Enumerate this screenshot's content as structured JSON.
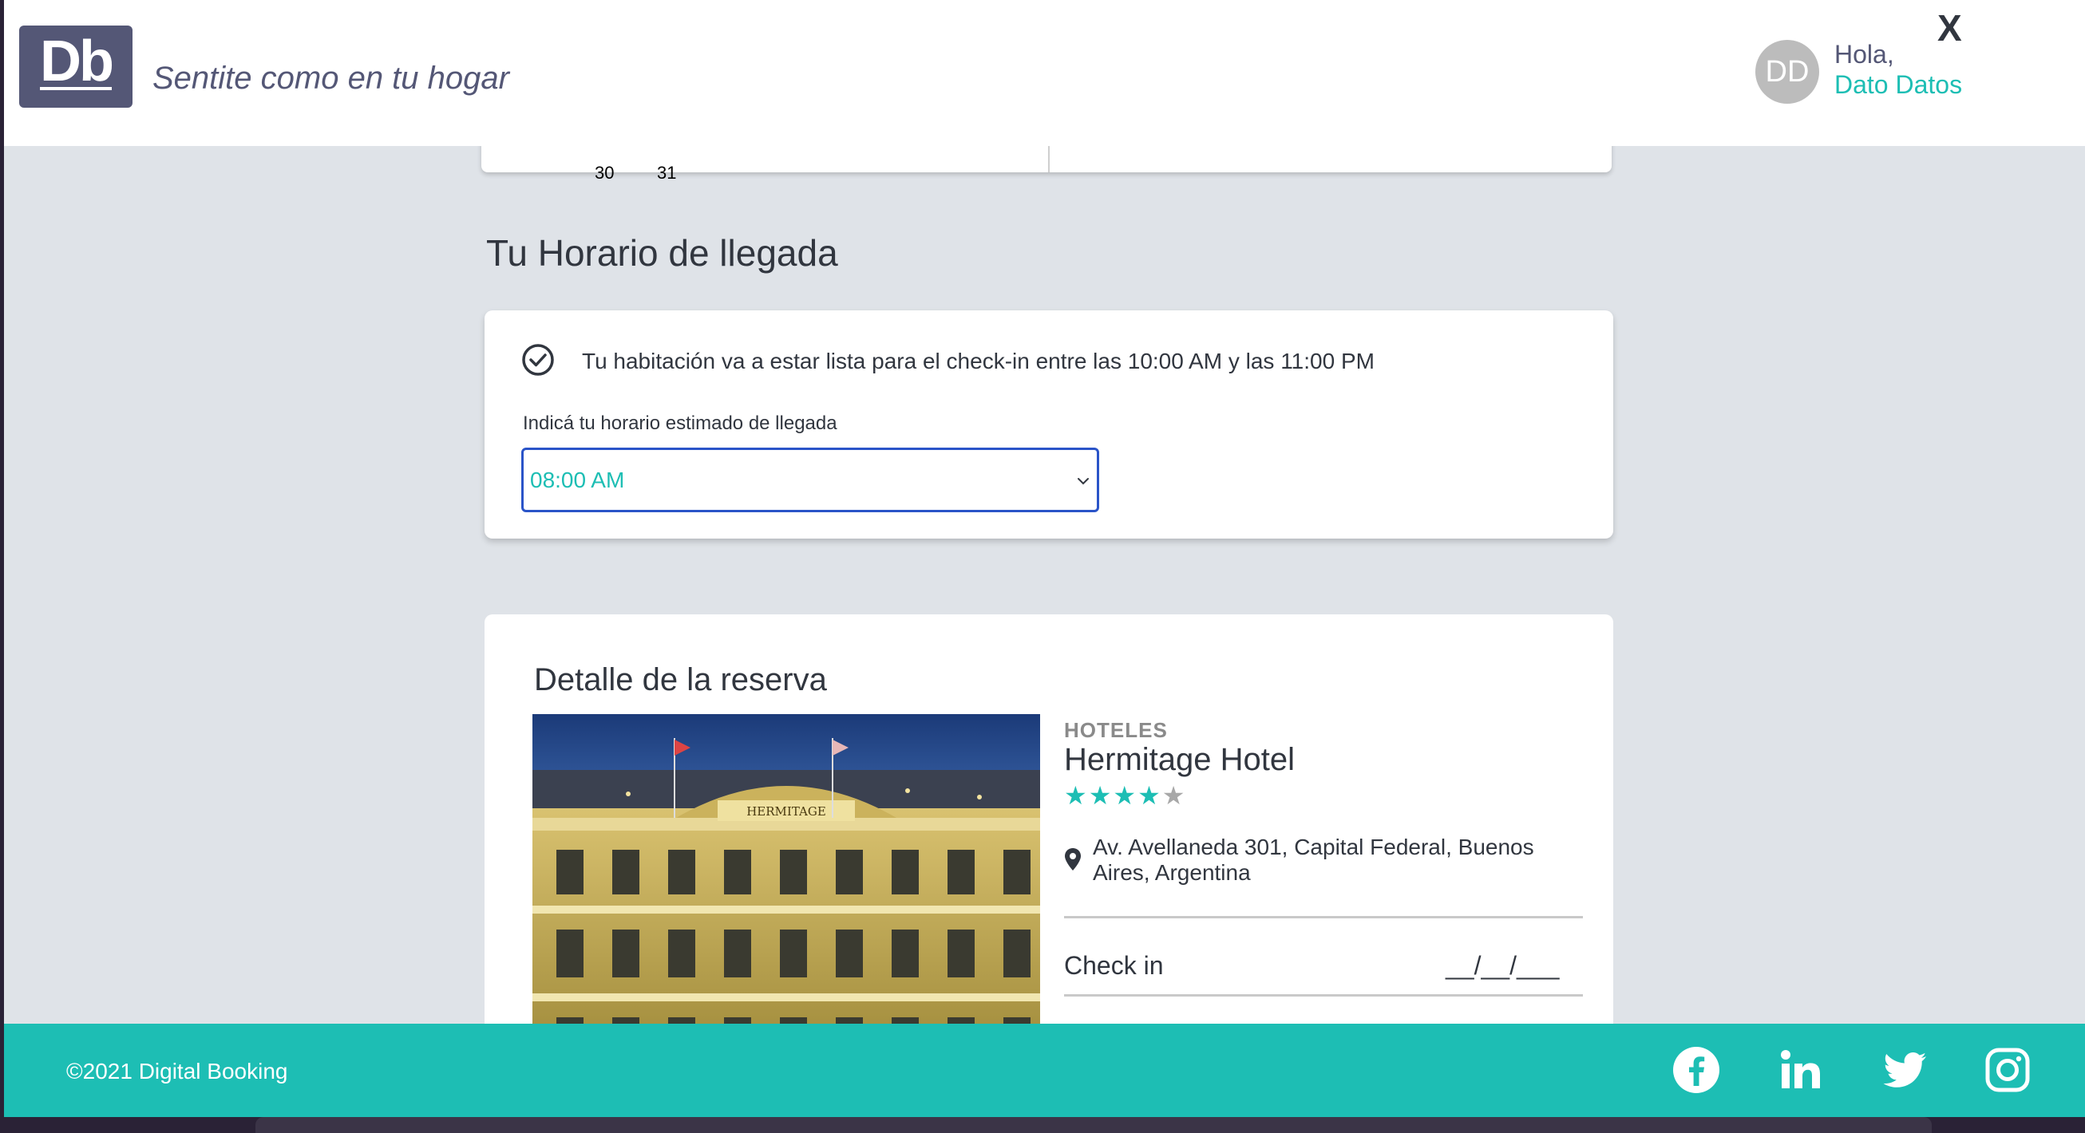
{
  "header": {
    "logo_text": "Db",
    "tagline": "Sentite como en tu hogar",
    "avatar_initials": "DD",
    "greeting": "Hola,",
    "user_name": "Dato Datos",
    "close_label": "X"
  },
  "calendar": {
    "visible_days": [
      "30",
      "31"
    ]
  },
  "arrival": {
    "section_title": "Tu Horario de llegada",
    "message": "Tu habitación va a estar lista para el check-in entre las 10:00 AM y las 11:00 PM",
    "label": "Indicá tu horario estimado de llegada",
    "selected_time": "08:00 AM"
  },
  "detail": {
    "title": "Detalle de la reserva",
    "category": "HOTELES",
    "hotel_name": "Hermitage Hotel",
    "rating": 4,
    "rating_max": 5,
    "address": "Av. Avellaneda 301, Capital Federal, Buenos Aires, Argentina",
    "checkin_label": "Check in",
    "checkin_value": "__/__/___",
    "image_sign": "HERMITAGE"
  },
  "footer": {
    "copyright": "©2021 Digital Booking",
    "social": [
      "facebook-icon",
      "linkedin-icon",
      "twitter-icon",
      "instagram-icon"
    ]
  },
  "colors": {
    "brand": "#545776",
    "accent": "#1dbeb4",
    "text": "#31363f",
    "background": "#dfe3e8"
  }
}
